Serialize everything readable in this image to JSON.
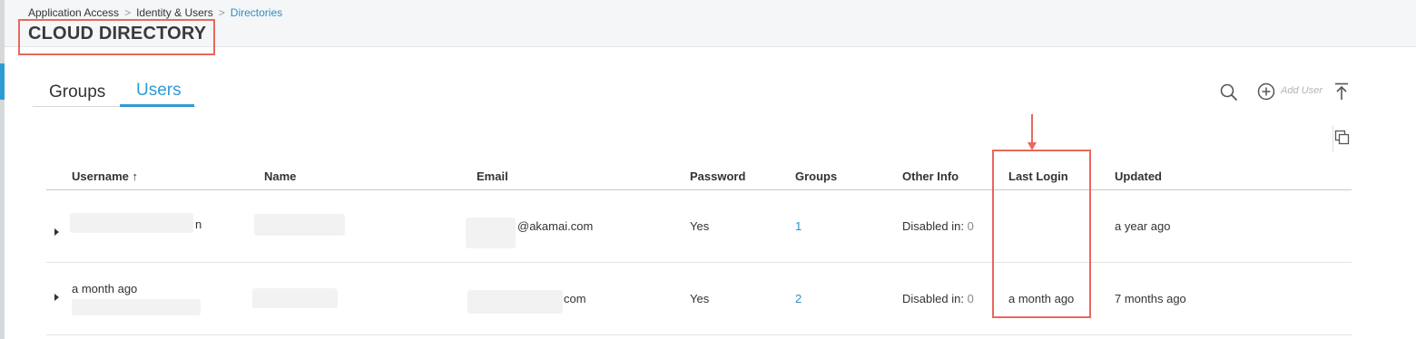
{
  "breadcrumb": {
    "items": [
      "Application Access",
      "Identity & Users"
    ],
    "separator": ">",
    "current": "Directories"
  },
  "page_title": "CLOUD DIRECTORY",
  "tabs": [
    {
      "label": "Groups",
      "active": false
    },
    {
      "label": "Users",
      "active": true
    }
  ],
  "toolbar": {
    "search_icon": "search-icon",
    "add_icon": "plus-circle-icon",
    "add_label": "Add User",
    "export_icon": "upload-icon",
    "columns_icon": "copy-icon"
  },
  "table": {
    "columns": [
      "Username",
      "Name",
      "Email",
      "Password",
      "Groups",
      "Other Info",
      "Last Login",
      "Updated"
    ],
    "sort_indicator": "↑",
    "rows": [
      {
        "username_visible": "n",
        "email_visible": "@akamai.com",
        "password": "Yes",
        "groups": "1",
        "other_info_label": "Disabled in:",
        "other_info_value": "0",
        "last_login": "",
        "updated": "a year ago"
      },
      {
        "username_visible": "a month ago",
        "email_visible": "com",
        "password": "Yes",
        "groups": "2",
        "other_info_label": "Disabled in:",
        "other_info_value": "0",
        "last_login": "a month ago",
        "updated": "7 months ago"
      }
    ]
  },
  "colors": {
    "accent": "#2e9bd6",
    "annotation": "#e8685e"
  }
}
